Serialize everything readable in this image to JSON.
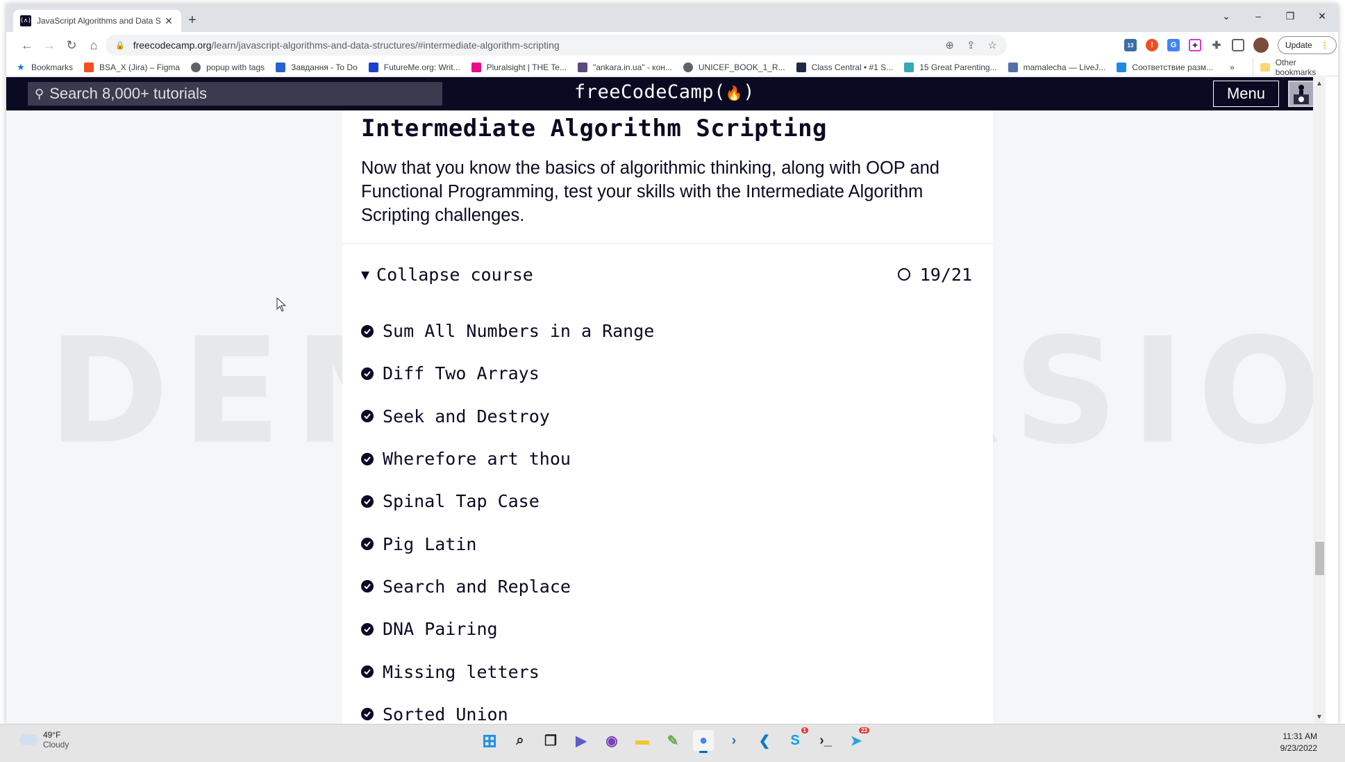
{
  "browser": {
    "tab": {
      "title": "JavaScript Algorithms and Data S",
      "favicon": "freecodecamp-icon"
    },
    "new_tab": "+",
    "window_controls": {
      "dropdown": "⌄",
      "minimize": "–",
      "restore": "❐",
      "close": "✕"
    },
    "url": {
      "host": "freecodecamp.org",
      "path": "/learn/javascript-algorithms-and-data-structures/#intermediate-algorithm-scripting"
    },
    "update_label": "Update",
    "extension_badge": "13",
    "bookmarks": [
      {
        "label": "Bookmarks",
        "icon": "star-icon",
        "color": "#1a73e8"
      },
      {
        "label": "BSA_X (Jira) – Figma",
        "icon": "figma-icon",
        "color": "#f24e1e"
      },
      {
        "label": "popup with tags",
        "icon": "globe-icon",
        "color": "#5f6368"
      },
      {
        "label": "Завдання - To Do",
        "icon": "todo-check-icon",
        "color": "#2564cf"
      },
      {
        "label": "FutureMe.org: Writ...",
        "icon": "futureme-icon",
        "color": "#1a3fd1"
      },
      {
        "label": "Pluralsight | THE Te...",
        "icon": "pluralsight-icon",
        "color": "#e80a89"
      },
      {
        "label": "\"ankara.in.ua\" - кон...",
        "icon": "ankara-icon",
        "color": "#5b4a7a"
      },
      {
        "label": "UNICEF_BOOK_1_R...",
        "icon": "globe-icon",
        "color": "#5f6368"
      },
      {
        "label": "Class Central • #1 S...",
        "icon": "classcentral-icon",
        "color": "#1f2a44"
      },
      {
        "label": "15 Great Parenting...",
        "icon": "parenting-icon",
        "color": "#3aa7b8"
      },
      {
        "label": "mamalecha — LiveJ...",
        "icon": "livejournal-user-icon",
        "color": "#5570a8"
      },
      {
        "label": "Соответствие разм...",
        "icon": "size-chart-icon",
        "color": "#1e88e5"
      }
    ],
    "bookmarks_overflow": "»",
    "other_bookmarks": "Other bookmarks"
  },
  "fcc": {
    "search_placeholder": "Search 8,000+ tutorials",
    "logo": "freeCodeCamp(🔥)",
    "logo_text": "freeCodeCamp",
    "menu_label": "Menu",
    "section": {
      "title": "Intermediate Algorithm Scripting",
      "description": "Now that you know the basics of algorithmic thinking, along with OOP and Functional Programming, test your skills with the Intermediate Algorithm Scripting challenges.",
      "collapse_label": "Collapse course",
      "progress": "19/21",
      "challenges": [
        {
          "title": "Sum All Numbers in a Range",
          "completed": true
        },
        {
          "title": "Diff Two Arrays",
          "completed": true
        },
        {
          "title": "Seek and Destroy",
          "completed": true
        },
        {
          "title": "Wherefore art thou",
          "completed": true
        },
        {
          "title": "Spinal Tap Case",
          "completed": true
        },
        {
          "title": "Pig Latin",
          "completed": true
        },
        {
          "title": "Search and Replace",
          "completed": true
        },
        {
          "title": "DNA Pairing",
          "completed": true
        },
        {
          "title": "Missing letters",
          "completed": true
        },
        {
          "title": "Sorted Union",
          "completed": true
        }
      ]
    },
    "watermark": "DEMO VERSION"
  },
  "taskbar": {
    "weather": {
      "temp": "49°F",
      "condition": "Cloudy"
    },
    "apps": [
      {
        "name": "start-icon",
        "color": "#1e90e8"
      },
      {
        "name": "search-icon",
        "color": "#202020"
      },
      {
        "name": "task-view-icon",
        "color": "#202020"
      },
      {
        "name": "teams-chat-icon",
        "color": "#5b5fc7"
      },
      {
        "name": "github-desktop-icon",
        "color": "#7b3fb5"
      },
      {
        "name": "file-explorer-icon",
        "color": "#f4c430"
      },
      {
        "name": "notepad-plus-icon",
        "color": "#6aa84f"
      },
      {
        "name": "chrome-icon",
        "color": "#4285f4",
        "active": true
      },
      {
        "name": "powershell-icon",
        "color": "#2b6cd8"
      },
      {
        "name": "vscode-icon",
        "color": "#0a7acc"
      },
      {
        "name": "skype-icon",
        "color": "#00a2ed",
        "badge": "1"
      },
      {
        "name": "terminal-icon",
        "color": "#2d2d2d"
      },
      {
        "name": "telegram-icon",
        "color": "#2aa3df",
        "badge": "23"
      }
    ],
    "time": "11:31 AM",
    "date": "9/23/2022"
  }
}
